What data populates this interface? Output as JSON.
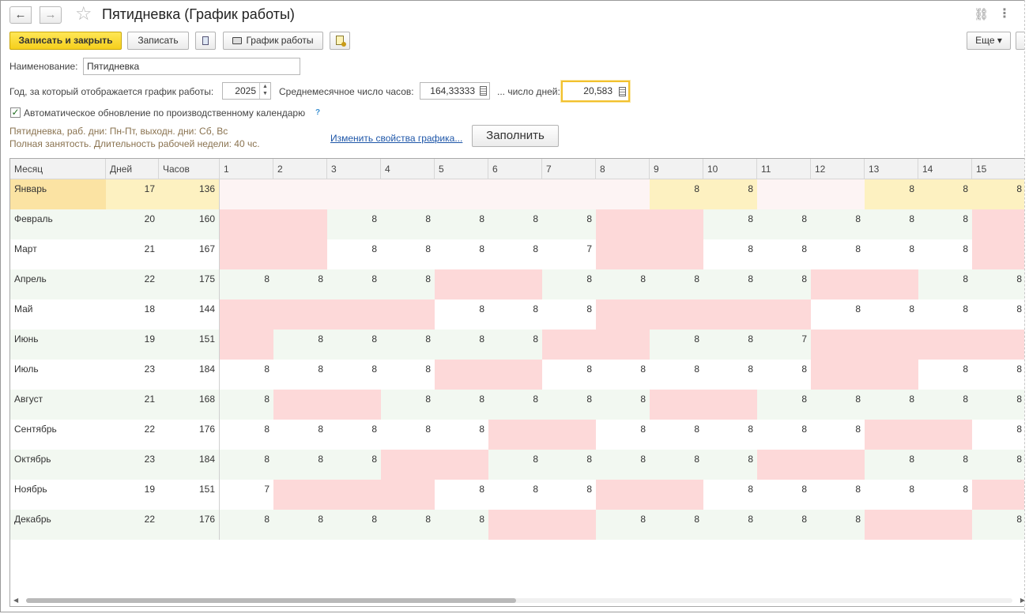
{
  "window": {
    "title": "Пятидневка (График работы)",
    "back_icon": "←",
    "forward_icon": "→",
    "star_icon": "☆",
    "link_icon": "🔗",
    "more_icon": "⋮"
  },
  "toolbar": {
    "save_close_label": "Записать и закрыть",
    "save_label": "Записать",
    "schedule_label": "График работы",
    "more_label": "Еще ▾"
  },
  "form": {
    "name_label": "Наименование:",
    "name_value": "Пятидневка",
    "year_label": "Год, за который отображается график работы:",
    "year_value": "2025",
    "avg_hours_label": "Среднемесячное число часов:",
    "avg_hours_value": "164,33333",
    "days_label": "... число дней:",
    "days_value": "20,583",
    "auto_update_label": "Автоматическое обновление по производственному календарю",
    "auto_update_checked": "✓",
    "help": "?",
    "info_line1": "Пятидневка, раб. дни: Пн-Пт, выходн. дни: Сб, Вс",
    "info_line2": "Полная занятость. Длительность рабочей недели: 40 чс.",
    "change_link": "Изменить свойства графика...",
    "fill_button": "Заполнить"
  },
  "table": {
    "headers": {
      "month": "Месяц",
      "days": "Дней",
      "hours": "Часов",
      "d": [
        "1",
        "2",
        "3",
        "4",
        "5",
        "6",
        "7",
        "8",
        "9",
        "10",
        "11",
        "12",
        "13",
        "14",
        "15"
      ]
    },
    "rows": [
      {
        "month": "Январь",
        "days": "17",
        "hours": "136",
        "d": [
          "",
          "",
          "",
          "",
          "",
          "",
          "",
          "",
          "8",
          "8",
          "",
          "",
          "8",
          "8",
          "8"
        ]
      },
      {
        "month": "Февраль",
        "days": "20",
        "hours": "160",
        "d": [
          "",
          "",
          "8",
          "8",
          "8",
          "8",
          "8",
          "",
          "",
          "8",
          "8",
          "8",
          "8",
          "8",
          ""
        ]
      },
      {
        "month": "Март",
        "days": "21",
        "hours": "167",
        "d": [
          "",
          "",
          "8",
          "8",
          "8",
          "8",
          "7",
          "",
          "",
          "8",
          "8",
          "8",
          "8",
          "8",
          ""
        ]
      },
      {
        "month": "Апрель",
        "days": "22",
        "hours": "175",
        "d": [
          "8",
          "8",
          "8",
          "8",
          "",
          "",
          "8",
          "8",
          "8",
          "8",
          "8",
          "",
          "",
          "8",
          "8"
        ]
      },
      {
        "month": "Май",
        "days": "18",
        "hours": "144",
        "d": [
          "",
          "",
          "",
          "",
          "8",
          "8",
          "8",
          "",
          "",
          "",
          "",
          "8",
          "8",
          "8",
          "8"
        ]
      },
      {
        "month": "Июнь",
        "days": "19",
        "hours": "151",
        "d": [
          "",
          "8",
          "8",
          "8",
          "8",
          "8",
          "",
          "",
          "8",
          "8",
          "7",
          "",
          "",
          "",
          ""
        ]
      },
      {
        "month": "Июль",
        "days": "23",
        "hours": "184",
        "d": [
          "8",
          "8",
          "8",
          "8",
          "",
          "",
          "8",
          "8",
          "8",
          "8",
          "8",
          "",
          "",
          "8",
          "8"
        ]
      },
      {
        "month": "Август",
        "days": "21",
        "hours": "168",
        "d": [
          "8",
          "",
          "",
          "8",
          "8",
          "8",
          "8",
          "8",
          "",
          "",
          "8",
          "8",
          "8",
          "8",
          "8"
        ]
      },
      {
        "month": "Сентябрь",
        "days": "22",
        "hours": "176",
        "d": [
          "8",
          "8",
          "8",
          "8",
          "8",
          "",
          "",
          "8",
          "8",
          "8",
          "8",
          "8",
          "",
          "",
          "8"
        ]
      },
      {
        "month": "Октябрь",
        "days": "23",
        "hours": "184",
        "d": [
          "8",
          "8",
          "8",
          "",
          "",
          "8",
          "8",
          "8",
          "8",
          "8",
          "",
          "",
          "8",
          "8",
          "8"
        ]
      },
      {
        "month": "Ноябрь",
        "days": "19",
        "hours": "151",
        "d": [
          "7",
          "",
          "",
          "",
          "8",
          "8",
          "8",
          "",
          "",
          "8",
          "8",
          "8",
          "8",
          "8",
          ""
        ]
      },
      {
        "month": "Декабрь",
        "days": "22",
        "hours": "176",
        "d": [
          "8",
          "8",
          "8",
          "8",
          "8",
          "",
          "",
          "8",
          "8",
          "8",
          "8",
          "8",
          "",
          "",
          "8"
        ]
      }
    ]
  },
  "holidays": [
    [
      1,
      2,
      3,
      4,
      5,
      6,
      7,
      8,
      11,
      12
    ],
    [
      1,
      2,
      8,
      9,
      15
    ],
    [
      1,
      2,
      8,
      9,
      15
    ],
    [
      5,
      6,
      12,
      13
    ],
    [
      1,
      2,
      3,
      4,
      8,
      9,
      10,
      11
    ],
    [
      1,
      7,
      8,
      12,
      13,
      14,
      15
    ],
    [
      5,
      6,
      12,
      13
    ],
    [
      2,
      3,
      9,
      10
    ],
    [
      6,
      7,
      13,
      14
    ],
    [
      4,
      5,
      11,
      12
    ],
    [
      2,
      3,
      4,
      8,
      9,
      15
    ],
    [
      6,
      7,
      13,
      14
    ]
  ]
}
